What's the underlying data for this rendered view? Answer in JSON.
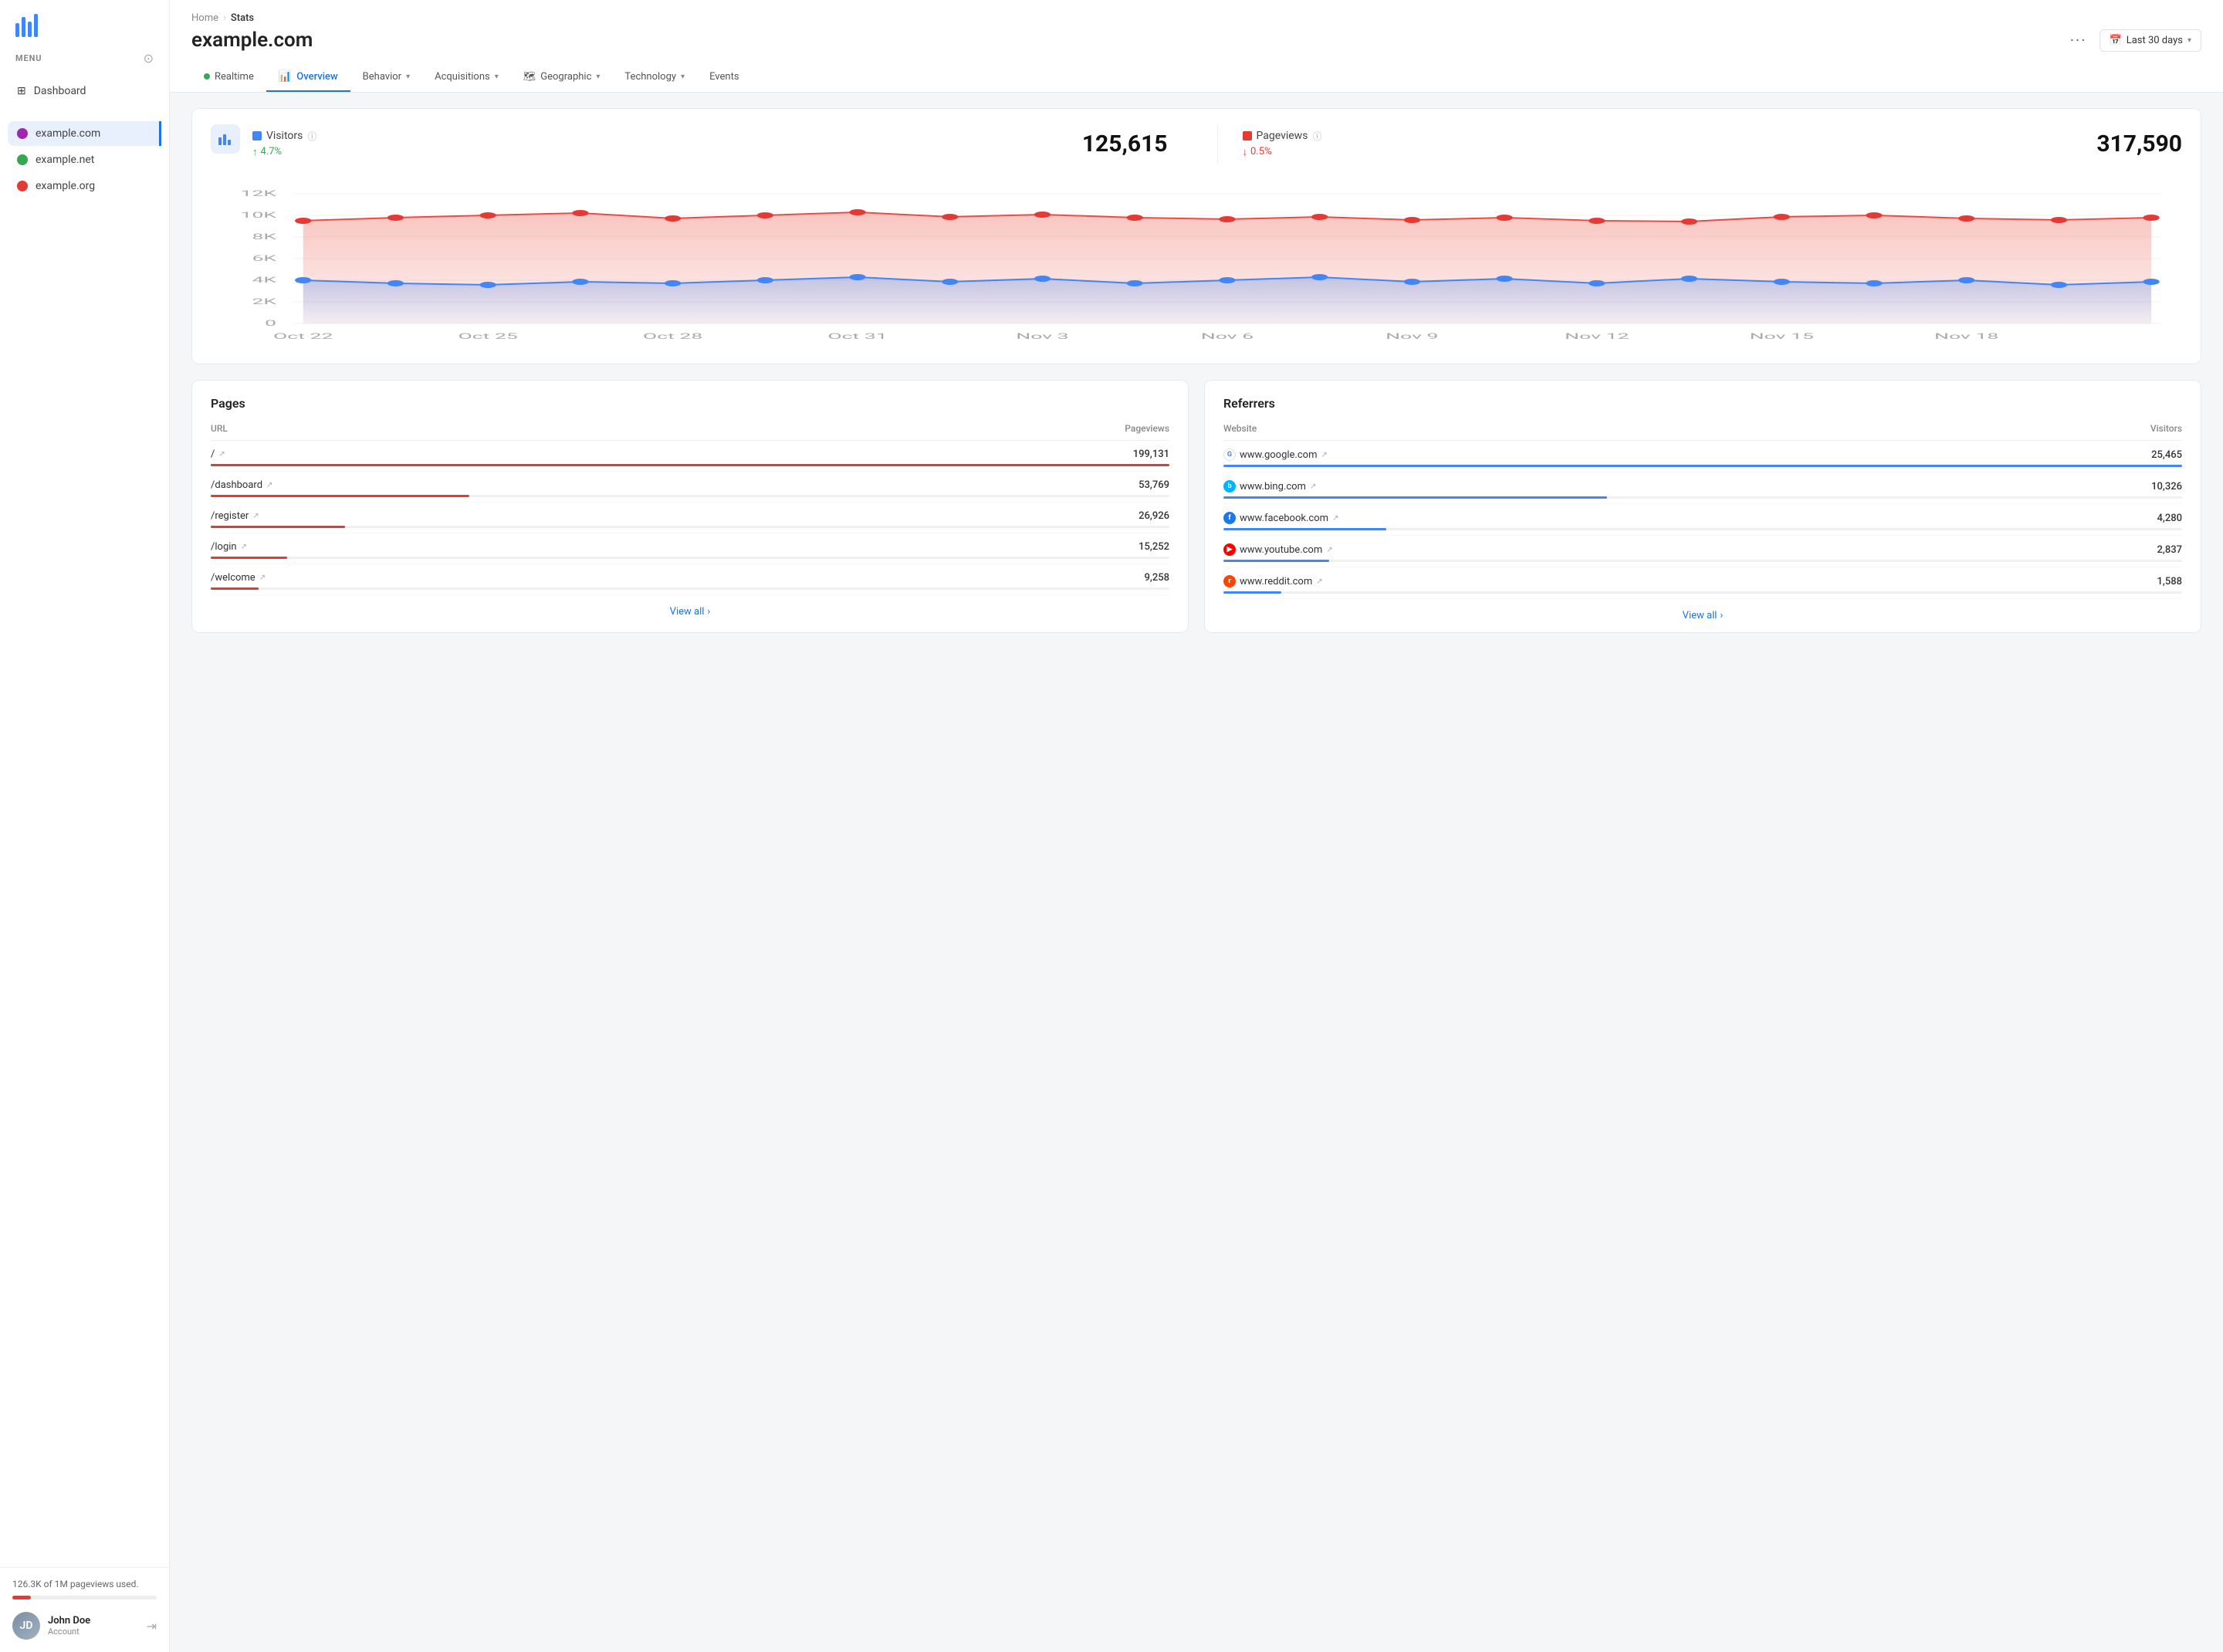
{
  "sidebar": {
    "menu_label": "MENU",
    "nav_items": [
      {
        "id": "dashboard",
        "label": "Dashboard",
        "icon": "grid"
      }
    ],
    "sites": [
      {
        "id": "example-com",
        "label": "example.com",
        "color": "#9c27b0",
        "active": true
      },
      {
        "id": "example-net",
        "label": "example.net",
        "color": "#34a853",
        "active": false
      },
      {
        "id": "example-org",
        "label": "example.org",
        "color": "#e53935",
        "active": false
      }
    ],
    "pageviews_used_label": "126.3K of 1M pageviews used.",
    "pageviews_percent": 12.63,
    "user": {
      "name": "John Doe",
      "role": "Account",
      "initials": "JD"
    }
  },
  "header": {
    "breadcrumb_home": "Home",
    "breadcrumb_current": "Stats",
    "page_title": "example.com",
    "dots": "···",
    "date_label": "Last 30 days"
  },
  "tabs": [
    {
      "id": "realtime",
      "label": "Realtime",
      "type": "dot"
    },
    {
      "id": "overview",
      "label": "Overview",
      "type": "icon",
      "active": true
    },
    {
      "id": "behavior",
      "label": "Behavior",
      "type": "dropdown"
    },
    {
      "id": "acquisitions",
      "label": "Acquisitions",
      "type": "dropdown"
    },
    {
      "id": "geographic",
      "label": "Geographic",
      "type": "dropdown"
    },
    {
      "id": "technology",
      "label": "Technology",
      "type": "dropdown"
    },
    {
      "id": "events",
      "label": "Events",
      "type": "icon"
    }
  ],
  "metrics": {
    "visitors": {
      "label": "Visitors",
      "value": "125,615",
      "change": "4.7%",
      "direction": "up"
    },
    "pageviews": {
      "label": "Pageviews",
      "value": "317,590",
      "change": "0.5%",
      "direction": "down"
    }
  },
  "chart": {
    "y_labels": [
      "12K",
      "10K",
      "8K",
      "6K",
      "4K",
      "2K",
      "0"
    ],
    "x_labels": [
      "Oct 22",
      "Oct 25",
      "Oct 28",
      "Oct 31",
      "Nov 3",
      "Nov 6",
      "Nov 9",
      "Nov 12",
      "Nov 15",
      "Nov 18"
    ]
  },
  "pages": {
    "title": "Pages",
    "col_url": "URL",
    "col_pageviews": "Pageviews",
    "rows": [
      {
        "url": "/",
        "value": "199,131",
        "bar_pct": 100
      },
      {
        "url": "/dashboard",
        "value": "53,769",
        "bar_pct": 27
      },
      {
        "url": "/register",
        "value": "26,926",
        "bar_pct": 14
      },
      {
        "url": "/login",
        "value": "15,252",
        "bar_pct": 8
      },
      {
        "url": "/welcome",
        "value": "9,258",
        "bar_pct": 5
      }
    ],
    "view_all": "View all"
  },
  "referrers": {
    "title": "Referrers",
    "col_website": "Website",
    "col_visitors": "Visitors",
    "rows": [
      {
        "site": "www.google.com",
        "value": "25,465",
        "bar_pct": 100,
        "color": "#4285f4",
        "icon_color": "#4285f4",
        "icon_letter": "G",
        "icon_bg": "#fff",
        "icon_border": "#4285f4"
      },
      {
        "site": "www.bing.com",
        "value": "10,326",
        "bar_pct": 40,
        "color": "#4285f4",
        "icon_color": "#00b4ff",
        "icon_letter": "b",
        "icon_bg": "#00b4ff"
      },
      {
        "site": "www.facebook.com",
        "value": "4,280",
        "bar_pct": 17,
        "color": "#4285f4",
        "icon_color": "#1877f2",
        "icon_letter": "f",
        "icon_bg": "#1877f2"
      },
      {
        "site": "www.youtube.com",
        "value": "2,837",
        "bar_pct": 11,
        "color": "#4285f4",
        "icon_color": "#ff0000",
        "icon_letter": "▶",
        "icon_bg": "#ff0000"
      },
      {
        "site": "www.reddit.com",
        "value": "1,588",
        "bar_pct": 6,
        "color": "#4285f4",
        "icon_color": "#ff4500",
        "icon_letter": "r",
        "icon_bg": "#ff4500"
      }
    ],
    "view_all": "View all"
  }
}
